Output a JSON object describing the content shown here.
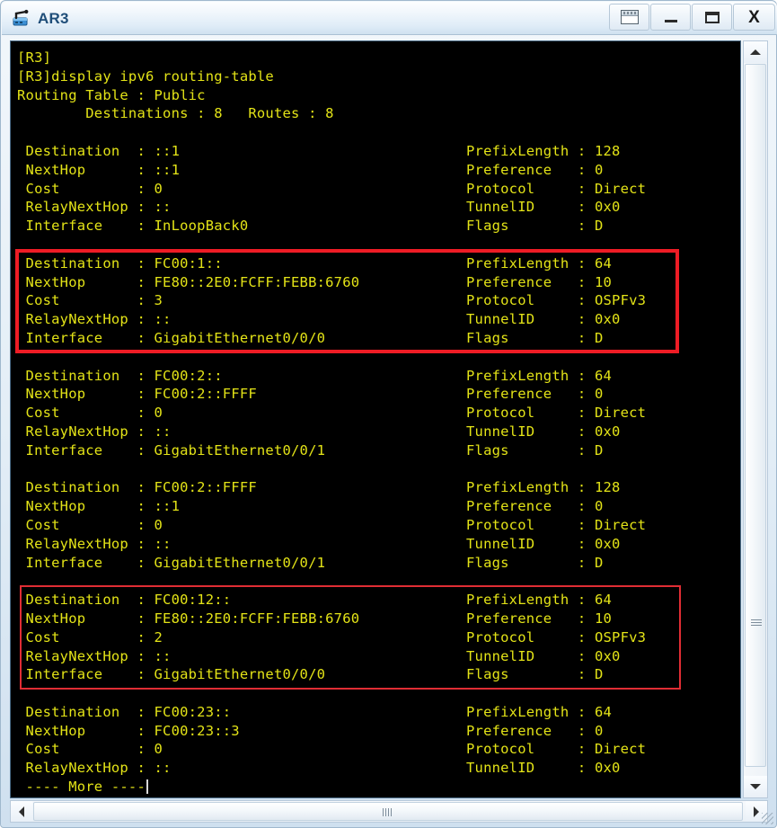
{
  "window": {
    "title": "AR3",
    "icon": "router-icon",
    "buttons": [
      {
        "name": "restore-small-button",
        "label": ""
      },
      {
        "name": "minimize-button",
        "label": ""
      },
      {
        "name": "maximize-button",
        "label": ""
      },
      {
        "name": "close-button",
        "label": "X"
      }
    ]
  },
  "console": {
    "prompt_lines": [
      "[R3]",
      "[R3]display ipv6 routing-table",
      "Routing Table : Public",
      "        Destinations : 8   Routes : 8"
    ],
    "more_prompt": " ---- More ----",
    "left_labels": [
      "Destination",
      "NextHop",
      "Cost",
      "RelayNextHop",
      "Interface"
    ],
    "right_labels": [
      "PrefixLength",
      "Preference",
      "Protocol",
      "TunnelID",
      "Flags"
    ],
    "routes": [
      {
        "highlighted": false,
        "destination": "::1",
        "nexthop": "::1",
        "cost": "0",
        "relaynexthop": "::",
        "interface": "InLoopBack0",
        "prefixlength": "128",
        "preference": "0",
        "protocol": "Direct",
        "tunnelid": "0x0",
        "flags": "D"
      },
      {
        "highlighted": true,
        "destination": "FC00:1::",
        "nexthop": "FE80::2E0:FCFF:FEBB:6760",
        "cost": "3",
        "relaynexthop": "::",
        "interface": "GigabitEthernet0/0/0",
        "prefixlength": "64",
        "preference": "10",
        "protocol": "OSPFv3",
        "tunnelid": "0x0",
        "flags": "D"
      },
      {
        "highlighted": false,
        "destination": "FC00:2::",
        "nexthop": "FC00:2::FFFF",
        "cost": "0",
        "relaynexthop": "::",
        "interface": "GigabitEthernet0/0/1",
        "prefixlength": "64",
        "preference": "0",
        "protocol": "Direct",
        "tunnelid": "0x0",
        "flags": "D"
      },
      {
        "highlighted": false,
        "destination": "FC00:2::FFFF",
        "nexthop": "::1",
        "cost": "0",
        "relaynexthop": "::",
        "interface": "GigabitEthernet0/0/1",
        "prefixlength": "128",
        "preference": "0",
        "protocol": "Direct",
        "tunnelid": "0x0",
        "flags": "D"
      },
      {
        "highlighted": true,
        "destination": "FC00:12::",
        "nexthop": "FE80::2E0:FCFF:FEBB:6760",
        "cost": "2",
        "relaynexthop": "::",
        "interface": "GigabitEthernet0/0/0",
        "prefixlength": "64",
        "preference": "10",
        "protocol": "OSPFv3",
        "tunnelid": "0x0",
        "flags": "D"
      },
      {
        "highlighted": false,
        "truncated": true,
        "destination": "FC00:23::",
        "nexthop": "FC00:23::3",
        "cost": "0",
        "relaynexthop": "::",
        "interface": "",
        "prefixlength": "64",
        "preference": "0",
        "protocol": "Direct",
        "tunnelid": "0x0",
        "flags": ""
      }
    ]
  },
  "colors": {
    "terminal_background": "#000000",
    "terminal_text": "#e3e317",
    "highlight_box": "#ee1c25",
    "title_text": "#1f4e79"
  },
  "scrollbars": {
    "vertical": {
      "up_arrow": "triangle-up",
      "down_arrow": "triangle-down"
    },
    "horizontal": {
      "left_arrow": "triangle-left",
      "right_arrow": "triangle-right"
    }
  }
}
